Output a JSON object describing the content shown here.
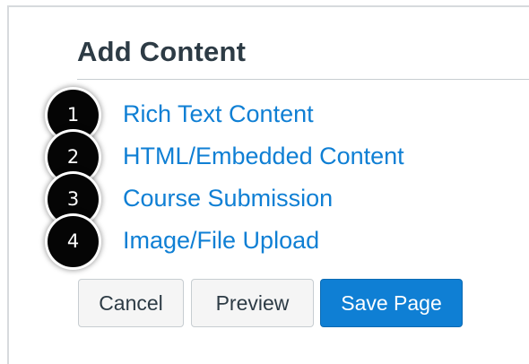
{
  "panel": {
    "title": "Add Content"
  },
  "options": [
    {
      "badge": "1",
      "label": "Rich Text Content"
    },
    {
      "badge": "2",
      "label": "HTML/Embedded Content"
    },
    {
      "badge": "3",
      "label": "Course Submission"
    },
    {
      "badge": "4",
      "label": "Image/File Upload"
    }
  ],
  "buttons": {
    "cancel": "Cancel",
    "preview": "Preview",
    "save": "Save Page"
  },
  "colors": {
    "link": "#0f7fd4",
    "primary_button": "#0f7fd4",
    "heading": "#2d3b45",
    "badge": "#050505"
  }
}
